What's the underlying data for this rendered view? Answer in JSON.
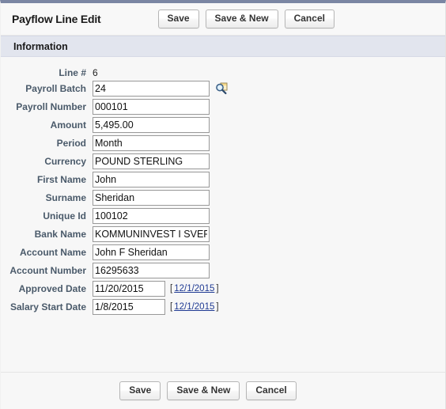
{
  "header": {
    "title": "Payflow Line Edit",
    "buttons": [
      {
        "label": "Save",
        "name": "save-button"
      },
      {
        "label": "Save & New",
        "name": "save-and-new-button"
      },
      {
        "label": "Cancel",
        "name": "cancel-button"
      }
    ]
  },
  "section": {
    "title": "Information"
  },
  "fields": [
    {
      "label": "Line #",
      "value": "6",
      "type": "readonly"
    },
    {
      "label": "Payroll Batch",
      "value": "24",
      "type": "lookup"
    },
    {
      "label": "Payroll Number",
      "value": "000101",
      "type": "text"
    },
    {
      "label": "Amount",
      "value": "5,495.00",
      "type": "text"
    },
    {
      "label": "Period",
      "value": "Month",
      "type": "text"
    },
    {
      "label": "Currency",
      "value": "POUND STERLING",
      "type": "text"
    },
    {
      "label": "First Name",
      "value": "John",
      "type": "text"
    },
    {
      "label": "Surname",
      "value": "Sheridan",
      "type": "text"
    },
    {
      "label": "Unique Id",
      "value": "100102",
      "type": "text"
    },
    {
      "label": "Bank Name",
      "value": "KOMMUNINVEST I SVERIGE",
      "type": "text"
    },
    {
      "label": "Account Name",
      "value": "John F Sheridan",
      "type": "text"
    },
    {
      "label": "Account Number",
      "value": "16295633",
      "type": "text"
    },
    {
      "label": "Approved Date",
      "value": "11/20/2015",
      "type": "date",
      "today_link": "12/1/2015"
    },
    {
      "label": "Salary Start Date",
      "value": "1/8/2015",
      "type": "date",
      "today_link": "12/1/2015"
    }
  ],
  "footer": {
    "buttons": [
      {
        "label": "Save",
        "name": "save-button-bottom"
      },
      {
        "label": "Save & New",
        "name": "save-and-new-button-bottom"
      },
      {
        "label": "Cancel",
        "name": "cancel-button-bottom"
      }
    ]
  },
  "icons": {
    "lookup": "search-lookup-icon"
  },
  "colors": {
    "top_rule": "#7b86a3",
    "section_band": "#e2e5ee",
    "label_text": "#4a5a6a",
    "link": "#1f3a93"
  }
}
